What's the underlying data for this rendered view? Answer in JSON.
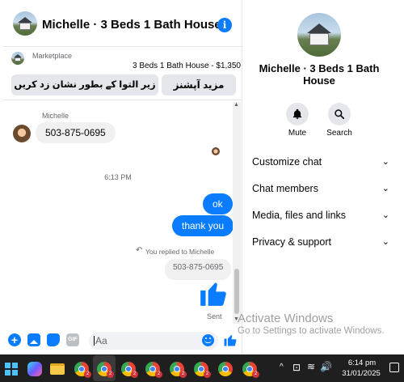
{
  "header": {
    "title": "Michelle · 3 Beds 1 Bath House",
    "info_icon": "info-icon"
  },
  "marketplace": {
    "label": "Marketplace",
    "listing": "3 Beds 1 Bath House - $1,350",
    "buttons": [
      "زیر التوا کے بطور نشان زد کریں",
      "مزید آپشنز"
    ]
  },
  "messages": {
    "sender_name": "Michelle",
    "incoming_phone": "503-875-0695",
    "timestamp": "6:13 PM",
    "outgoing": [
      "ok",
      "thank you"
    ],
    "reply_note": "You replied to Michelle",
    "quoted": "503-875-0695",
    "sent_status": "Sent"
  },
  "composer": {
    "placeholder": "Aa"
  },
  "details": {
    "name": "Michelle · 3 Beds 1 Bath House",
    "actions": [
      {
        "label": "Mute",
        "icon": "bell-icon"
      },
      {
        "label": "Search",
        "icon": "search-icon"
      }
    ],
    "menu": [
      "Customize chat",
      "Chat members",
      "Media, files and links",
      "Privacy & support"
    ]
  },
  "watermark": {
    "line1": "Activate Windows",
    "line2": "Go to Settings to activate Windows."
  },
  "taskbar": {
    "time": "6:14 pm",
    "date": "31/01/2025",
    "badges": [
      "2",
      "2",
      "2",
      "2",
      "2",
      "2",
      "2"
    ]
  },
  "colors": {
    "accent": "#0a7cff",
    "taskbar": "#1f1f1f"
  }
}
